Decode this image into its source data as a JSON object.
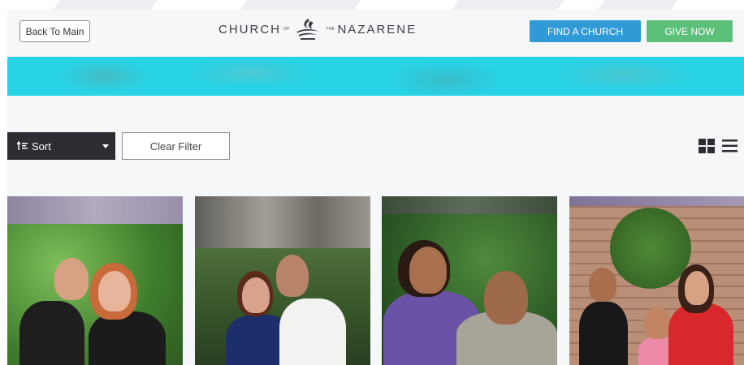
{
  "header": {
    "back_label": "Back To Main",
    "logo": {
      "left": "CHURCH",
      "of": "OF",
      "the": "THE",
      "right": "NAZARENE"
    },
    "find_label": "FIND A CHURCH",
    "give_label": "GIVE NOW"
  },
  "toolbar": {
    "sort_label": "Sort",
    "clear_label": "Clear Filter"
  },
  "icons": {
    "sort": "sort-icon",
    "caret": "caret-down-icon",
    "grid": "grid-view-icon",
    "list": "list-view-icon",
    "logo": "flame-logo-icon"
  },
  "colors": {
    "find_button": "#2f9ad6",
    "give_button": "#5cbf7a",
    "banner": "#27d3e5",
    "sort_button": "#2b2d33"
  },
  "cards": [
    {
      "name": "missionary-card-1"
    },
    {
      "name": "missionary-card-2"
    },
    {
      "name": "missionary-card-3"
    },
    {
      "name": "missionary-card-4"
    }
  ]
}
